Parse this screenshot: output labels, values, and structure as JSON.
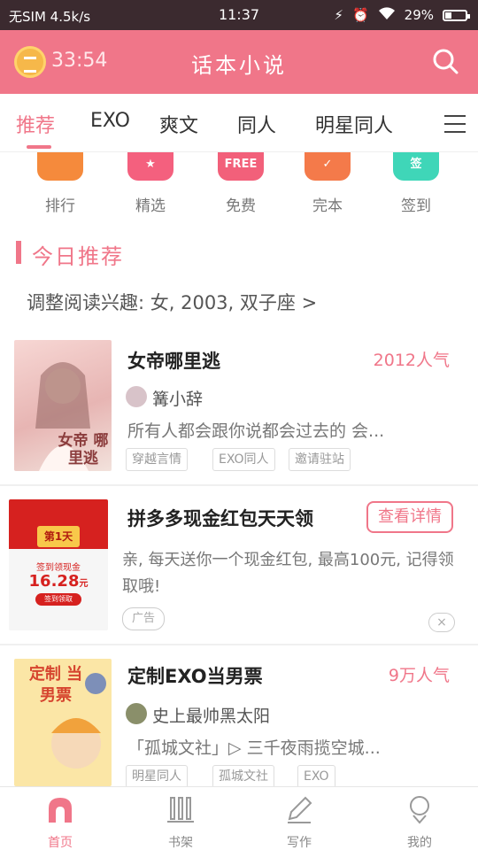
{
  "status_bar": {
    "carrier": "无SIM 4.5k/s",
    "time": "11:37",
    "battery": "29%"
  },
  "header": {
    "timer": "33:54",
    "title": "话本小说"
  },
  "tabs": [
    {
      "label": "推荐"
    },
    {
      "label": "EXO"
    },
    {
      "label": "爽文"
    },
    {
      "label": "同人"
    },
    {
      "label": "明星同人"
    }
  ],
  "categories": [
    {
      "label": "排行",
      "color": "#f58a3c",
      "icon": "trophy-icon"
    },
    {
      "label": "精选",
      "color": "#f4607e",
      "icon": "star-icon"
    },
    {
      "label": "免费",
      "icon_text": "FREE",
      "color": "#f2607a",
      "icon": "free-icon"
    },
    {
      "label": "完本",
      "color": "#f47a4a",
      "icon": "check-icon"
    },
    {
      "label": "签到",
      "icon_text": "签",
      "color": "#3fd6b8",
      "icon": "signin-icon"
    }
  ],
  "section": {
    "title": "今日推荐",
    "interest": "调整阅读兴趣: 女, 2003, 双子座 >"
  },
  "books": [
    {
      "title": "女帝哪里逃",
      "popularity": "2012人气",
      "author": "篝小辞",
      "description": "所有人都会跟你说都会过去的 会...",
      "tags": [
        "穿越言情",
        "EXO同人",
        "邀请驻站"
      ],
      "cover_text": "女帝 哪里逃"
    },
    {
      "title": "定制EXO当男票",
      "popularity": "9万人气",
      "author": "史上最帅黑太阳",
      "description": "「孤城文社」▷ 三千夜雨揽空城...",
      "tags": [
        "明星同人",
        "孤城文社",
        "EXO"
      ],
      "cover_text": "定制 当男票"
    }
  ],
  "ad": {
    "title": "拼多多现金红包天天领",
    "button": "查看详情",
    "description": "亲, 每天送你一个现金红包, 最高100元, 记得领取哦!",
    "label": "广告",
    "close": "×",
    "cover_day": "第1天",
    "cover_caption": "签到领现金",
    "cover_amount": "16.28",
    "cover_amount_unit": "元",
    "cover_button": "签到领取"
  },
  "bottom_nav": [
    {
      "label": "首页",
      "icon": "home-icon",
      "active": true
    },
    {
      "label": "书架",
      "icon": "bookshelf-icon"
    },
    {
      "label": "写作",
      "icon": "pen-icon"
    },
    {
      "label": "我的",
      "icon": "profile-icon"
    }
  ],
  "colors": {
    "accent": "#f07689",
    "status_bar": "#3b2a2f"
  }
}
